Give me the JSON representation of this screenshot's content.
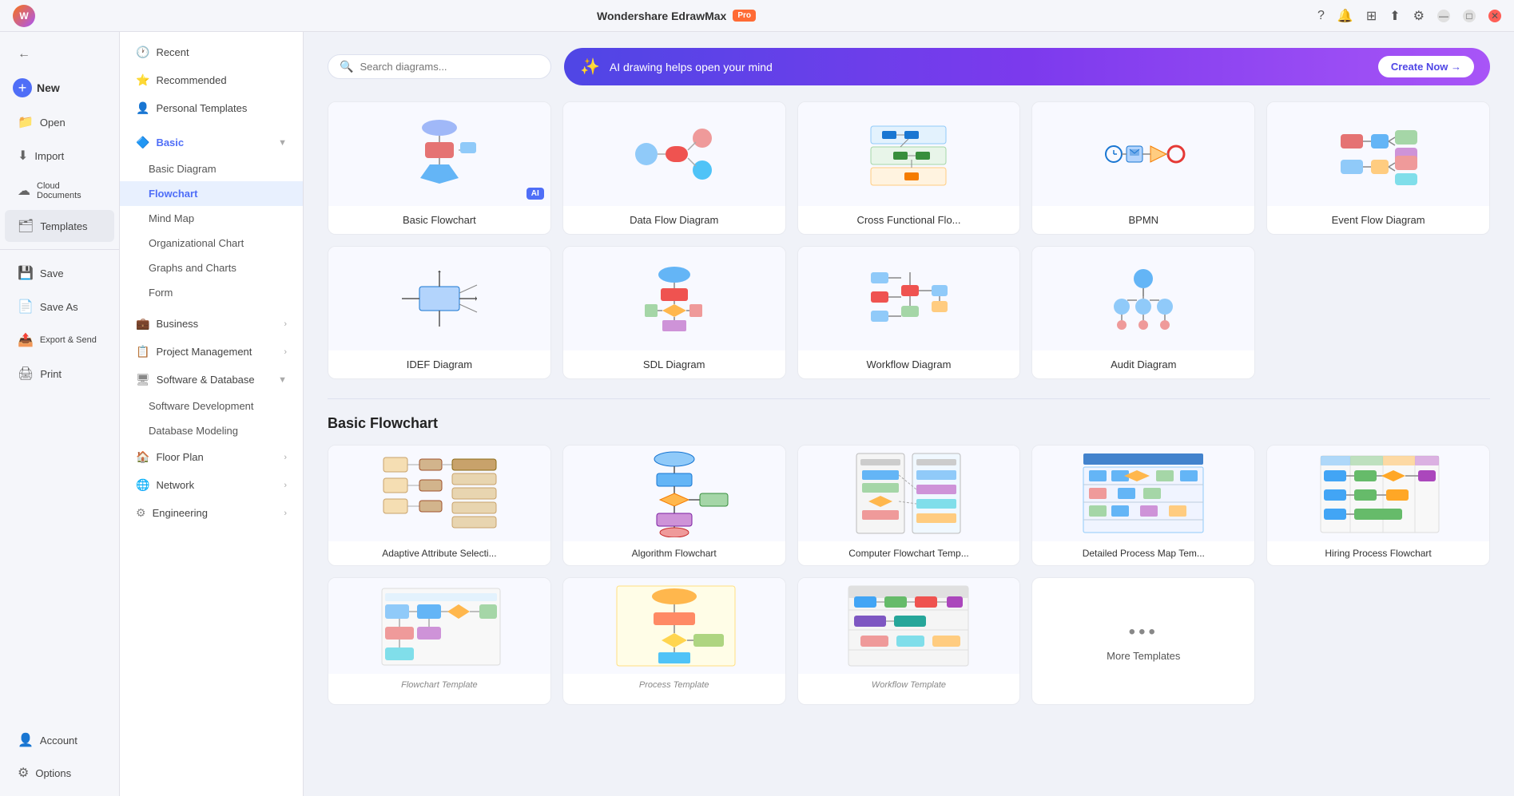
{
  "app": {
    "title": "Wondershare EdrawMax",
    "pro_badge": "Pro"
  },
  "titlebar": {
    "minimize_label": "—",
    "maximize_label": "□",
    "close_label": "✕",
    "avatar_initials": "W",
    "help_icon": "?",
    "bell_icon": "🔔",
    "grid_icon": "⊞",
    "upload_icon": "⬆",
    "settings_icon": "⚙"
  },
  "sidebar": {
    "back_label": "←",
    "new_label": "New",
    "open_label": "Open",
    "import_label": "Import",
    "cloud_label": "Cloud Documents",
    "templates_label": "Templates",
    "save_label": "Save",
    "save_as_label": "Save As",
    "export_label": "Export & Send",
    "print_label": "Print",
    "account_label": "Account",
    "options_label": "Options"
  },
  "categories": {
    "recent_label": "Recent",
    "recommended_label": "Recommended",
    "personal_label": "Personal Templates",
    "basic_label": "Basic",
    "basic_diagram_label": "Basic Diagram",
    "flowchart_label": "Flowchart",
    "mind_map_label": "Mind Map",
    "org_chart_label": "Organizational Chart",
    "graphs_label": "Graphs and Charts",
    "form_label": "Form",
    "business_label": "Business",
    "project_label": "Project Management",
    "software_label": "Software & Database",
    "software_dev_label": "Software Development",
    "database_label": "Database Modeling",
    "floor_plan_label": "Floor Plan",
    "network_label": "Network",
    "engineering_label": "Engineering"
  },
  "topbar": {
    "search_placeholder": "Search diagrams...",
    "ai_text": "AI drawing helps open your mind",
    "create_now_label": "Create Now →"
  },
  "diagram_types": [
    {
      "label": "Basic Flowchart",
      "has_ai": true
    },
    {
      "label": "Data Flow Diagram",
      "has_ai": false
    },
    {
      "label": "Cross Functional Flo...",
      "has_ai": false
    },
    {
      "label": "BPMN",
      "has_ai": false
    },
    {
      "label": "Event Flow Diagram",
      "has_ai": false
    },
    {
      "label": "IDEF Diagram",
      "has_ai": false
    },
    {
      "label": "SDL Diagram",
      "has_ai": false
    },
    {
      "label": "Workflow Diagram",
      "has_ai": false
    },
    {
      "label": "Audit Diagram",
      "has_ai": false
    }
  ],
  "section_title": "Basic Flowchart",
  "templates": [
    {
      "label": "Adaptive Attribute Selecti..."
    },
    {
      "label": "Algorithm Flowchart"
    },
    {
      "label": "Computer Flowchart Temp..."
    },
    {
      "label": "Detailed Process Map Tem..."
    },
    {
      "label": "Hiring Process Flowchart"
    },
    {
      "label": ""
    },
    {
      "label": ""
    },
    {
      "label": ""
    },
    {
      "label": ""
    }
  ],
  "more_templates": {
    "dots": "•••",
    "label": "More Templates"
  }
}
